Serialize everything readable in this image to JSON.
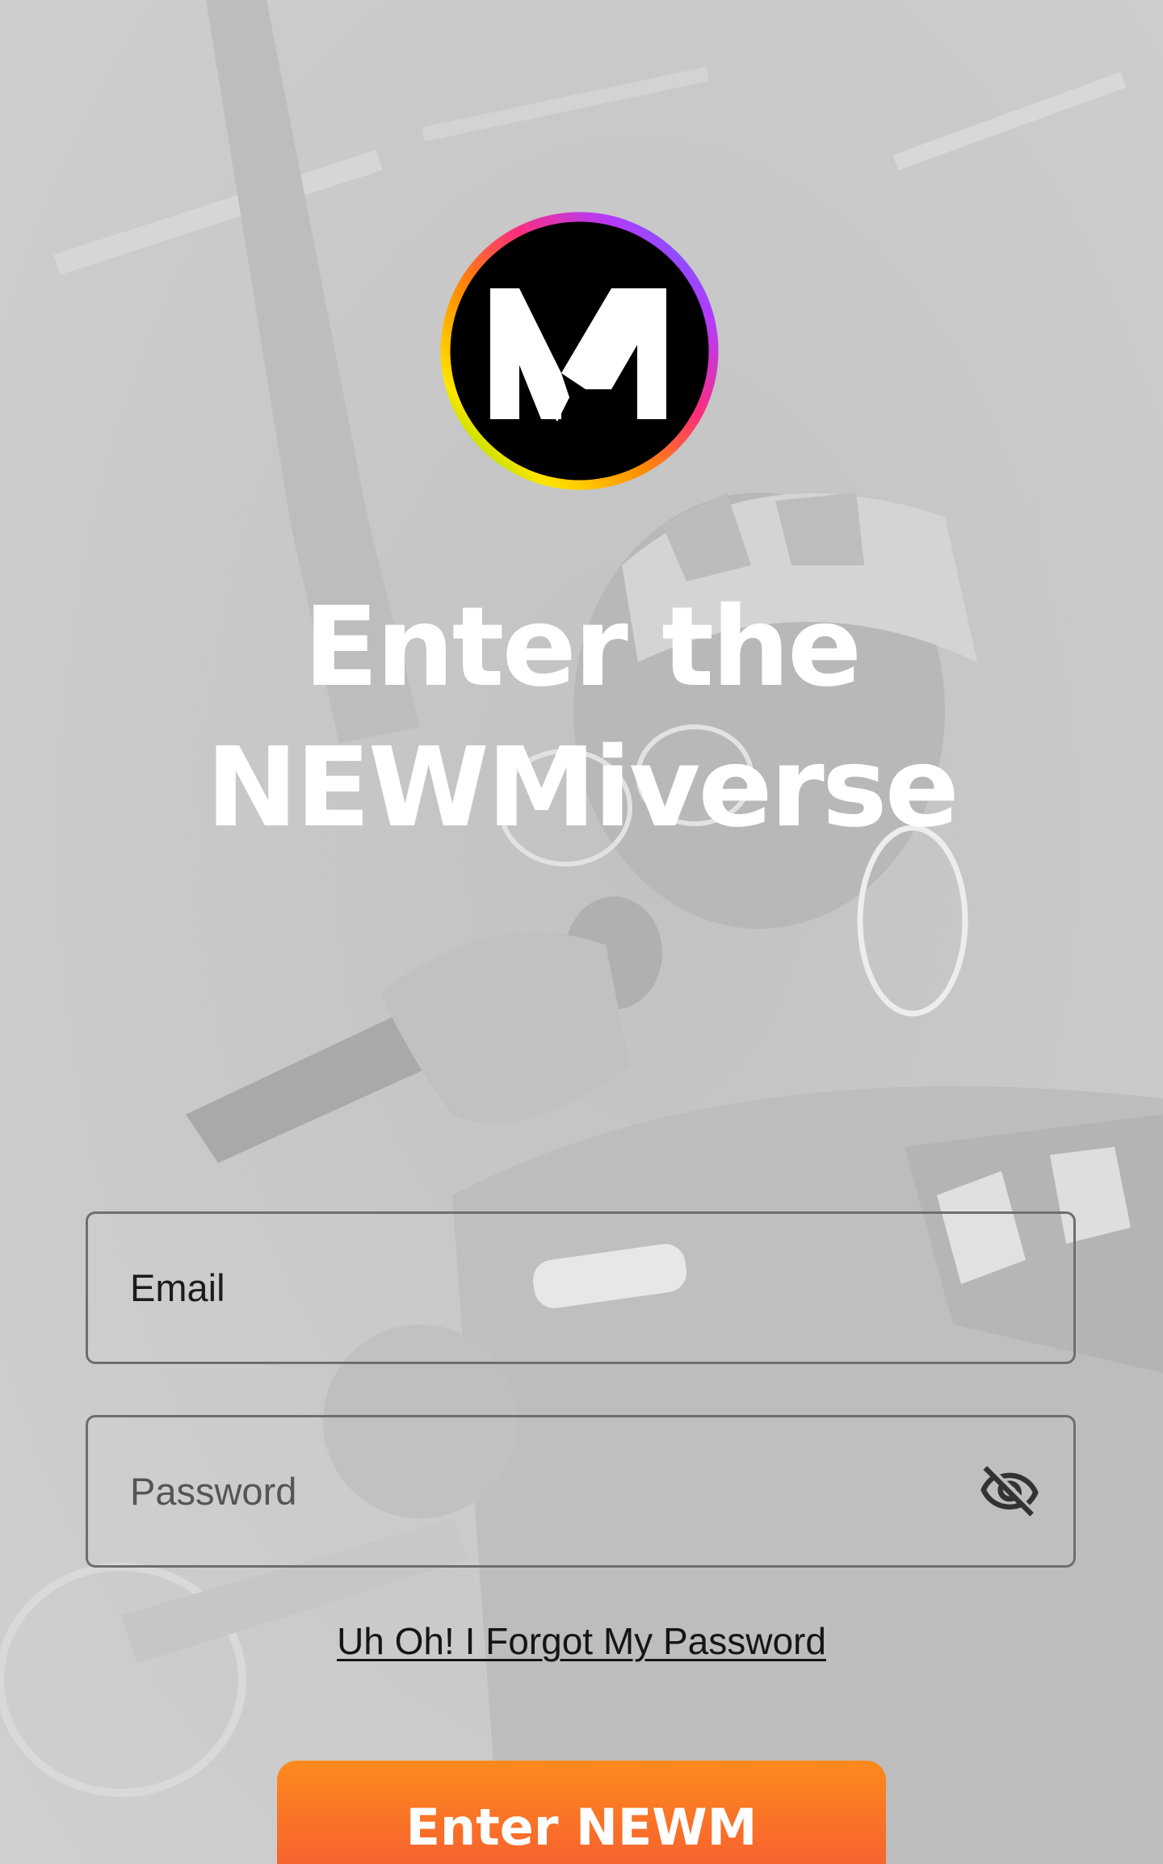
{
  "background": {
    "icon": "concert-singer-photo"
  },
  "logo": {
    "icon": "newm-logo-icon",
    "ring_colors": [
      "#2b7cff",
      "#b13cff",
      "#ff2d7a",
      "#ff8a00",
      "#ffe500",
      "#38e000"
    ]
  },
  "headline": {
    "line1": "Enter the",
    "line2": "NEWMiverse"
  },
  "form": {
    "email": {
      "placeholder": "Email",
      "value": ""
    },
    "password": {
      "placeholder": "Password",
      "value": "",
      "toggle_icon": "eye-off-icon"
    },
    "forgot_link": "Uh Oh! I Forgot My Password",
    "submit_label": "Enter NEWM"
  },
  "colors": {
    "accent_top": "#fd8a1d",
    "accent_bottom": "#f25c35",
    "text_light": "#ffffff"
  }
}
